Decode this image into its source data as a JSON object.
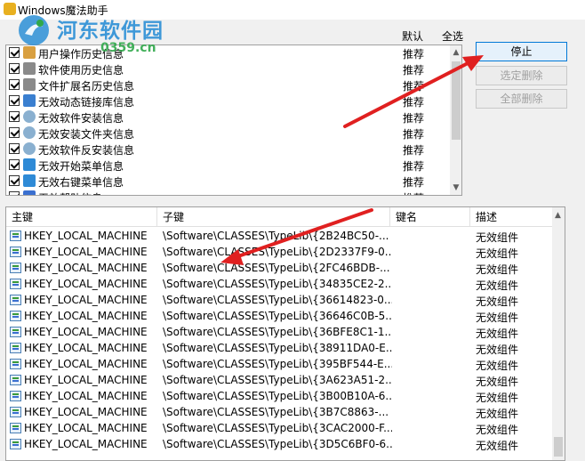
{
  "window": {
    "title": "Windows魔法助手"
  },
  "watermark": {
    "text": "河东软件园",
    "url": "0359.cn"
  },
  "top_list": {
    "headers": {
      "default": "默认",
      "select_all": "全选"
    },
    "items": [
      {
        "label": "用户操作历史信息",
        "default": "推荐",
        "icon": "history-icon"
      },
      {
        "label": "软件使用历史信息",
        "default": "推荐",
        "icon": "key-icon"
      },
      {
        "label": "文件扩展名历史信息",
        "default": "推荐",
        "icon": "key-icon"
      },
      {
        "label": "无效动态链接库信息",
        "default": "推荐",
        "icon": "library-icon"
      },
      {
        "label": "无效软件安装信息",
        "default": "推荐",
        "icon": "install-disc-icon"
      },
      {
        "label": "无效安装文件夹信息",
        "default": "推荐",
        "icon": "install-disc-icon"
      },
      {
        "label": "无效软件反安装信息",
        "default": "推荐",
        "icon": "install-disc-icon"
      },
      {
        "label": "无效开始菜单信息",
        "default": "推荐",
        "icon": "start-menu-icon"
      },
      {
        "label": "无效右键菜单信息",
        "default": "推荐",
        "icon": "start-menu-icon"
      },
      {
        "label": "无效帮助信息",
        "default": "推荐",
        "icon": "help-icon"
      }
    ]
  },
  "buttons": {
    "stop": "停止",
    "delete_selected": "选定删除",
    "delete_all": "全部删除"
  },
  "bottom_list": {
    "columns": [
      "主键",
      "子键",
      "键名",
      "描述"
    ],
    "rows": [
      {
        "main": "HKEY_LOCAL_MACHINE",
        "sub": "\\Software\\CLASSES\\TypeLib\\{2B24BC50-...",
        "key": "",
        "desc": "无效组件"
      },
      {
        "main": "HKEY_LOCAL_MACHINE",
        "sub": "\\Software\\CLASSES\\TypeLib\\{2D2337F9-0...",
        "key": "",
        "desc": "无效组件"
      },
      {
        "main": "HKEY_LOCAL_MACHINE",
        "sub": "\\Software\\CLASSES\\TypeLib\\{2FC46BDB-...",
        "key": "",
        "desc": "无效组件"
      },
      {
        "main": "HKEY_LOCAL_MACHINE",
        "sub": "\\Software\\CLASSES\\TypeLib\\{34835CE2-2...",
        "key": "",
        "desc": "无效组件"
      },
      {
        "main": "HKEY_LOCAL_MACHINE",
        "sub": "\\Software\\CLASSES\\TypeLib\\{36614823-0...",
        "key": "",
        "desc": "无效组件"
      },
      {
        "main": "HKEY_LOCAL_MACHINE",
        "sub": "\\Software\\CLASSES\\TypeLib\\{36646C0B-5...",
        "key": "",
        "desc": "无效组件"
      },
      {
        "main": "HKEY_LOCAL_MACHINE",
        "sub": "\\Software\\CLASSES\\TypeLib\\{36BFE8C1-1...",
        "key": "",
        "desc": "无效组件"
      },
      {
        "main": "HKEY_LOCAL_MACHINE",
        "sub": "\\Software\\CLASSES\\TypeLib\\{38911DA0-E...",
        "key": "",
        "desc": "无效组件"
      },
      {
        "main": "HKEY_LOCAL_MACHINE",
        "sub": "\\Software\\CLASSES\\TypeLib\\{395BF544-E...",
        "key": "",
        "desc": "无效组件"
      },
      {
        "main": "HKEY_LOCAL_MACHINE",
        "sub": "\\Software\\CLASSES\\TypeLib\\{3A623A51-2...",
        "key": "",
        "desc": "无效组件"
      },
      {
        "main": "HKEY_LOCAL_MACHINE",
        "sub": "\\Software\\CLASSES\\TypeLib\\{3B00B10A-6...",
        "key": "",
        "desc": "无效组件"
      },
      {
        "main": "HKEY_LOCAL_MACHINE",
        "sub": "\\Software\\CLASSES\\TypeLib\\{3B7C8863-...",
        "key": "",
        "desc": "无效组件"
      },
      {
        "main": "HKEY_LOCAL_MACHINE",
        "sub": "\\Software\\CLASSES\\TypeLib\\{3CAC2000-F...",
        "key": "",
        "desc": "无效组件"
      },
      {
        "main": "HKEY_LOCAL_MACHINE",
        "sub": "\\Software\\CLASSES\\TypeLib\\{3D5C6BF0-6...",
        "key": "",
        "desc": "无效组件"
      }
    ]
  },
  "colors": {
    "annotation_arrow": "#e02020",
    "watermark_blue": "#2b8fd6",
    "watermark_green": "#2fa84a"
  }
}
